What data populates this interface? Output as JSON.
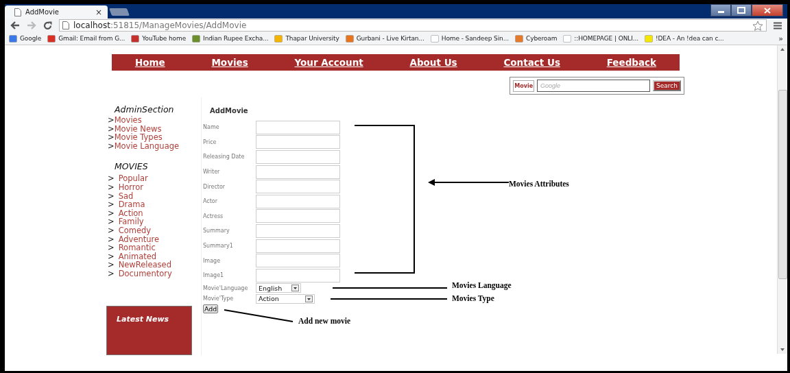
{
  "browser": {
    "tab_title": "AddMovie",
    "tab_close": "×",
    "address": {
      "host": "localhost",
      "path": ":51815/ManageMovies/AddMovie"
    },
    "bookmarks": [
      {
        "label": "Google"
      },
      {
        "label": "Gmail: Email from G..."
      },
      {
        "label": "YouTube home"
      },
      {
        "label": "Indian Rupee Excha..."
      },
      {
        "label": "Thapar University"
      },
      {
        "label": "Gurbani - Live Kirtan..."
      },
      {
        "label": "Home - Sandeep Sin..."
      },
      {
        "label": "Cyberoam"
      },
      {
        "label": "::HOMEPAGE | ONLI..."
      },
      {
        "label": "!DEA - An !dea can c..."
      }
    ],
    "more": "»"
  },
  "nav": [
    "Home",
    "Movies",
    "Your Account",
    "About Us",
    "Contact Us",
    "Feedback"
  ],
  "search": {
    "category": "Movie",
    "placeholder": "Google",
    "button": "Search"
  },
  "sidebar": {
    "admin": {
      "title": "AdminSection",
      "items": [
        {
          "bullet": ">",
          "label": "Movies"
        },
        {
          "bullet": ">",
          "label": "Movie News"
        },
        {
          "bullet": ">",
          "label": "Movie Types"
        },
        {
          "bullet": ">",
          "label": "Movie Language"
        }
      ]
    },
    "movies": {
      "title": "MOVIES",
      "items": [
        {
          "bullet": ">",
          "label": "Popular"
        },
        {
          "bullet": ">",
          "label": "Horror"
        },
        {
          "bullet": ">",
          "label": "Sad"
        },
        {
          "bullet": ">",
          "label": "Drama"
        },
        {
          "bullet": ">",
          "label": "Action"
        },
        {
          "bullet": ">",
          "label": "Family"
        },
        {
          "bullet": ">",
          "label": "Comedy"
        },
        {
          "bullet": ">",
          "label": "Adventure"
        },
        {
          "bullet": ">",
          "label": "Romantic"
        },
        {
          "bullet": ">",
          "label": "Animated"
        },
        {
          "bullet": ">",
          "label": "NewReleased"
        },
        {
          "bullet": ">",
          "label": "Documentory"
        }
      ]
    },
    "latest_news": "Latest News"
  },
  "form": {
    "title": "AddMovie",
    "fields": [
      {
        "label": "Name"
      },
      {
        "label": "Price"
      },
      {
        "label": "Releasing Date"
      },
      {
        "label": "Writer"
      },
      {
        "label": "Director"
      },
      {
        "label": "Actor"
      },
      {
        "label": "Actress"
      },
      {
        "label": "Summary"
      },
      {
        "label": "Summary1"
      },
      {
        "label": "Image"
      },
      {
        "label": "Image1"
      }
    ],
    "selects": [
      {
        "label": "Movie'Language",
        "value": "English"
      },
      {
        "label": "Movie'Type",
        "value": "Action"
      }
    ],
    "button": "Add"
  },
  "annotations": [
    "Movies Attributes",
    "Movies Language",
    "Movies Type",
    "Add new movie"
  ]
}
